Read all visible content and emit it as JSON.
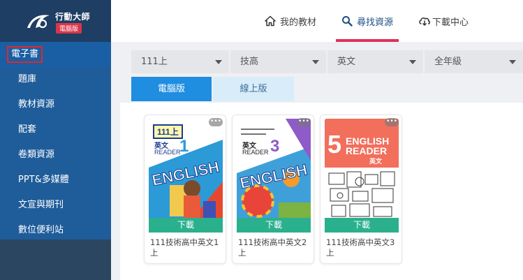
{
  "app": {
    "name": "行動大師",
    "badge": "電腦版"
  },
  "sidebar": {
    "items": [
      {
        "label": "電子書",
        "active": true
      },
      {
        "label": "題庫"
      },
      {
        "label": "教材資源"
      },
      {
        "label": "配套"
      },
      {
        "label": "卷類資源"
      },
      {
        "label": "PPT&多媒體"
      },
      {
        "label": "文宣與期刊"
      },
      {
        "label": "數位便利站"
      }
    ]
  },
  "topnav": {
    "tabs": [
      {
        "label": "我的教材",
        "icon": "home-icon"
      },
      {
        "label": "尋找資源",
        "icon": "search-icon",
        "active": true
      },
      {
        "label": "下載中心",
        "icon": "cloud-download-icon"
      }
    ]
  },
  "filters": {
    "year": "111上",
    "school": "技高",
    "subject": "英文",
    "grade": "全年級"
  },
  "segments": {
    "desktop": "電腦版",
    "online": "線上版"
  },
  "books": [
    {
      "title": "111技術高中英文1上",
      "download": "下載",
      "cover": {
        "badge": "111上",
        "subject": "英文",
        "series": "READER",
        "volume": "1",
        "word": "ENGLISH"
      }
    },
    {
      "title": "111技術高中英文2上",
      "download": "下載",
      "cover": {
        "subject": "英文",
        "series": "READER",
        "volume": "3",
        "word": "ENGLISH"
      }
    },
    {
      "title": "111技術高中英文3上",
      "download": "下載",
      "cover": {
        "volume": "5",
        "word": "ENGLISH",
        "series": "READER",
        "subject": "英文"
      }
    }
  ],
  "more_label": "•••",
  "colors": {
    "sidebar": "#1f5c9a",
    "accent": "#e0305b",
    "download": "#2bb08e",
    "segment_active": "#1f8de0"
  }
}
